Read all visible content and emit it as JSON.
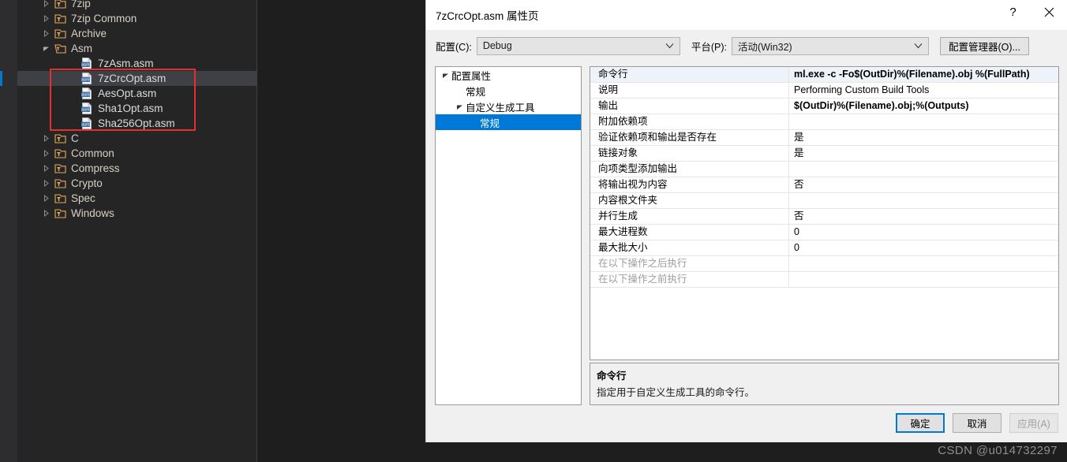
{
  "colors": {
    "ide_background": "#252526",
    "ide_gutter": "#2d2d30",
    "selection_blue": "#0078d7",
    "annotation_red": "#e03030",
    "folder_icon": "#e8ab5b",
    "tree_text": "#d7d0c4"
  },
  "solution_explorer": {
    "name": "Solution Explorer",
    "nodes": [
      {
        "label": "7zip",
        "kind": "filter",
        "depth": 1,
        "state": "collapsed",
        "selected": false
      },
      {
        "label": "7zip Common",
        "kind": "filter",
        "depth": 1,
        "state": "collapsed",
        "selected": false
      },
      {
        "label": "Archive",
        "kind": "filter",
        "depth": 1,
        "state": "collapsed",
        "selected": false
      },
      {
        "label": "Asm",
        "kind": "filter",
        "depth": 1,
        "state": "expanded",
        "selected": false
      },
      {
        "label": "7zAsm.asm",
        "kind": "asm-file",
        "depth": 2,
        "state": "leaf",
        "selected": false
      },
      {
        "label": "7zCrcOpt.asm",
        "kind": "asm-file",
        "depth": 2,
        "state": "leaf",
        "selected": true
      },
      {
        "label": "AesOpt.asm",
        "kind": "asm-file",
        "depth": 2,
        "state": "leaf",
        "selected": false
      },
      {
        "label": "Sha1Opt.asm",
        "kind": "asm-file",
        "depth": 2,
        "state": "leaf",
        "selected": false
      },
      {
        "label": "Sha256Opt.asm",
        "kind": "asm-file",
        "depth": 2,
        "state": "leaf",
        "selected": false
      },
      {
        "label": "C",
        "kind": "filter",
        "depth": 1,
        "state": "collapsed",
        "selected": false
      },
      {
        "label": "Common",
        "kind": "filter",
        "depth": 1,
        "state": "collapsed",
        "selected": false
      },
      {
        "label": "Compress",
        "kind": "filter",
        "depth": 1,
        "state": "collapsed",
        "selected": false
      },
      {
        "label": "Crypto",
        "kind": "filter",
        "depth": 1,
        "state": "collapsed",
        "selected": false
      },
      {
        "label": "Spec",
        "kind": "filter",
        "depth": 1,
        "state": "collapsed",
        "selected": false
      },
      {
        "label": "Windows",
        "kind": "filter",
        "depth": 1,
        "state": "collapsed",
        "selected": false
      }
    ]
  },
  "dialog": {
    "title": "7zCrcOpt.asm 属性页",
    "help_glyph": "?",
    "close_icon": "close-icon",
    "config": {
      "config_label": "配置(C):",
      "config_value": "Debug",
      "platform_label": "平台(P):",
      "platform_value": "活动(Win32)",
      "config_manager_label": "配置管理器(O)..."
    },
    "nav_tree": [
      {
        "label": "配置属性",
        "depth": 0,
        "state": "expanded",
        "selected": false
      },
      {
        "label": "常规",
        "depth": 1,
        "state": "leaf",
        "selected": false
      },
      {
        "label": "自定义生成工具",
        "depth": 1,
        "state": "expanded",
        "selected": false
      },
      {
        "label": "常规",
        "depth": 2,
        "state": "leaf",
        "selected": true
      }
    ],
    "properties": [
      {
        "name": "命令行",
        "value": "ml.exe -c -Fo$(OutDir)%(Filename).obj %(FullPath)",
        "bold": true,
        "selected": true,
        "disabled": false
      },
      {
        "name": "说明",
        "value": "Performing Custom Build Tools",
        "bold": false,
        "selected": false,
        "disabled": false
      },
      {
        "name": "输出",
        "value": "$(OutDir)%(Filename).obj;%(Outputs)",
        "bold": true,
        "selected": false,
        "disabled": false
      },
      {
        "name": "附加依赖项",
        "value": "",
        "bold": false,
        "selected": false,
        "disabled": false
      },
      {
        "name": "验证依赖项和输出是否存在",
        "value": "是",
        "bold": false,
        "selected": false,
        "disabled": false
      },
      {
        "name": "链接对象",
        "value": "是",
        "bold": false,
        "selected": false,
        "disabled": false
      },
      {
        "name": "向项类型添加输出",
        "value": "",
        "bold": false,
        "selected": false,
        "disabled": false
      },
      {
        "name": "将输出视为内容",
        "value": "否",
        "bold": false,
        "selected": false,
        "disabled": false
      },
      {
        "name": "内容根文件夹",
        "value": "",
        "bold": false,
        "selected": false,
        "disabled": false
      },
      {
        "name": "并行生成",
        "value": "否",
        "bold": false,
        "selected": false,
        "disabled": false
      },
      {
        "name": "最大进程数",
        "value": "0",
        "bold": false,
        "selected": false,
        "disabled": false
      },
      {
        "name": "最大批大小",
        "value": "0",
        "bold": false,
        "selected": false,
        "disabled": false
      },
      {
        "name": "在以下操作之后执行",
        "value": "",
        "bold": false,
        "selected": false,
        "disabled": true
      },
      {
        "name": "在以下操作之前执行",
        "value": "",
        "bold": false,
        "selected": false,
        "disabled": true
      }
    ],
    "description": {
      "title": "命令行",
      "body": "指定用于自定义生成工具的命令行。"
    },
    "footer": {
      "ok_label": "确定",
      "cancel_label": "取消",
      "apply_label": "应用(A)"
    }
  },
  "watermark": "CSDN @u014732297"
}
